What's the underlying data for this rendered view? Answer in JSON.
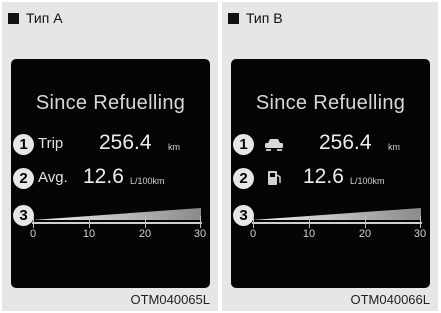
{
  "panels": [
    {
      "label": "Тип A",
      "figure_code": "OTM040065L",
      "screen": {
        "title": "Since Refuelling",
        "items": [
          {
            "number": "1",
            "label": "Trip",
            "value": "256.4",
            "unit": "km"
          },
          {
            "number": "2",
            "label": "Avg.",
            "value": "12.6",
            "unit": "L/100km"
          },
          {
            "number": "3"
          }
        ],
        "gauge_ticks": [
          "0",
          "10",
          "20",
          "30"
        ]
      }
    },
    {
      "label": "Тип B",
      "figure_code": "OTM040066L",
      "screen": {
        "title": "Since Refuelling",
        "items": [
          {
            "number": "1",
            "icon": "car-trip-icon",
            "value": "256.4",
            "unit": "km"
          },
          {
            "number": "2",
            "icon": "fuel-pump-icon",
            "value": "12.6",
            "unit": "L/100km"
          },
          {
            "number": "3"
          }
        ],
        "gauge_ticks": [
          "0",
          "10",
          "20",
          "30"
        ]
      }
    }
  ]
}
